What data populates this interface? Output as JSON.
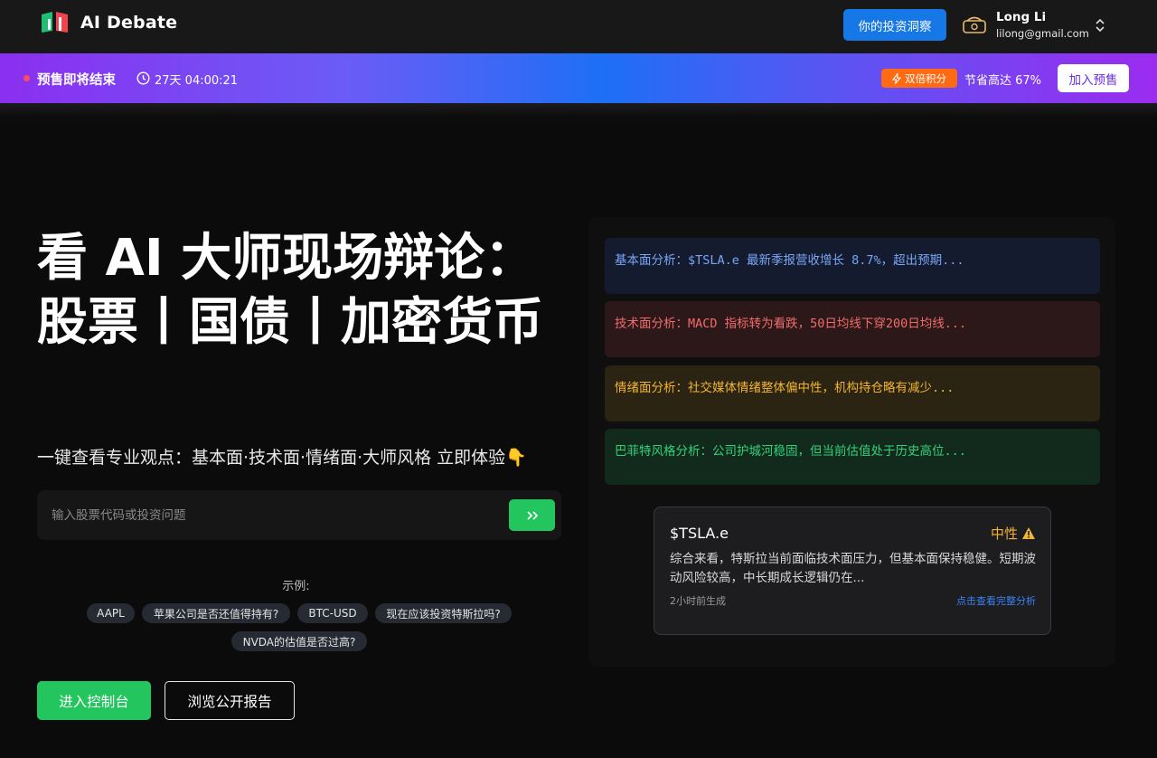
{
  "header": {
    "app_name": "AI Debate",
    "insight_button": "你的投资洞察",
    "user": {
      "name": "Long Li",
      "email": "lilong@gmail.com"
    }
  },
  "promo": {
    "title": "预售即将结束",
    "timer": "27天 04:00:21",
    "badge": "双倍积分",
    "savings": "节省高达 67%",
    "join_button": "加入预售"
  },
  "hero": {
    "title": "看 AI 大师现场辩论：股票丨国债丨加密货币",
    "subtitle": "一键查看专业观点：基本面·技术面·情绪面·大师风格 立即体验👇",
    "search_placeholder": "输入股票代码或投资问题",
    "examples_label": "示例:",
    "examples": [
      "AAPL",
      "苹果公司是否还值得持有?",
      "BTC-USD",
      "现在应该投资特斯拉吗?",
      "NVDA的估值是否过高?"
    ],
    "primary_cta": "进入控制台",
    "secondary_cta": "浏览公开报告"
  },
  "analyses": [
    {
      "text": "基本面分析：$TSLA.e 最新季报营收增长 8.7%，超出预期...",
      "color": "#79a6f7"
    },
    {
      "text": "技术面分析：MACD 指标转为看跌，50日均线下穿200日均线...",
      "color": "#f36b6b"
    },
    {
      "text": "情绪面分析：社交媒体情绪整体偏中性，机构持仓略有减少...",
      "color": "#f2b533"
    },
    {
      "text": "巴菲特风格分析：公司护城河稳固，但当前估值处于历史高位...",
      "color": "#33d17a"
    }
  ],
  "summary": {
    "ticker": "$TSLA.e",
    "sentiment": "中性",
    "text": "综合来看，特斯拉当前面临技术面压力，但基本面保持稳健。短期波动风险较高，中长期成长逻辑仍在...",
    "time": "2小时前生成",
    "link": "点击查看完整分析"
  },
  "colors": {
    "accent_blue": "#1677e6",
    "accent_green": "#22c55e",
    "warning": "#f2b533"
  }
}
